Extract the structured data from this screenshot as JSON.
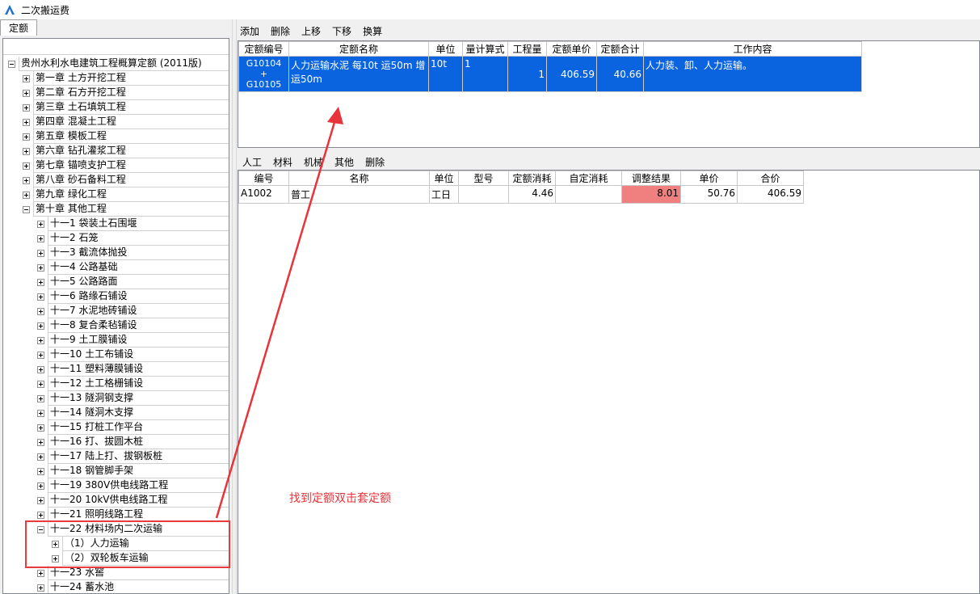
{
  "window": {
    "title": "二次搬运费",
    "icon": "app-logo-icon"
  },
  "left_tab": "定额",
  "tree": {
    "root": "贵州水利水电建筑工程概算定额 (2011版)",
    "chapters": [
      "第一章  土方开挖工程",
      "第二章  石方开挖工程",
      "第三章  土石填筑工程",
      "第四章  混凝土工程",
      "第五章  模板工程",
      "第六章  钻孔灌浆工程",
      "第七章  锚喷支护工程",
      "第八章  砂石备料工程",
      "第九章  绿化工程",
      "第十章  其他工程"
    ],
    "sections": [
      "十一1  袋装土石围堰",
      "十一2  石笼",
      "十一3  截流体抛投",
      "十一4  公路基础",
      "十一5  公路路面",
      "十一6  路缘石铺设",
      "十一7  水泥地砖铺设",
      "十一8  复合柔毡铺设",
      "十一9  土工膜铺设",
      "十一10  土工布铺设",
      "十一11  塑料薄膜铺设",
      "十一12  土工格栅铺设",
      "十一13  隧洞钢支撑",
      "十一14  隧洞木支撑",
      "十一15  打桩工作平台",
      "十一16  打、拔圆木桩",
      "十一17  陆上打、拔钢板桩",
      "十一18  钢管脚手架",
      "十一19  380V供电线路工程",
      "十一20  10kV供电线路工程",
      "十一21  照明线路工程",
      "十一22  材料场内二次运输"
    ],
    "subsections": [
      "（1）人力运输",
      "（2）双轮板车运输"
    ],
    "after": [
      "十一23  水窖",
      "十一24  蓄水池"
    ]
  },
  "top_toolbar": [
    "添加",
    "删除",
    "上移",
    "下移",
    "换算"
  ],
  "quota_table": {
    "headers": [
      "定额编号",
      "定额名称",
      "单位",
      "量计算式",
      "工程量",
      "定额单价",
      "定额合计",
      "工作内容"
    ],
    "rows": [
      {
        "code_line1": "G10104",
        "code_line2": "+",
        "code_line3": "G10105",
        "name": "人力运输水泥 每10t 运50m 增运50m",
        "unit": "10t",
        "formula": "1",
        "quantity": "1",
        "unit_price": "406.59",
        "total": "40.66",
        "work": "人力装、卸、人力运输。"
      }
    ]
  },
  "bottom_toolbar": [
    "人工",
    "材料",
    "机械",
    "其他",
    "删除"
  ],
  "resource_table": {
    "headers": [
      "编号",
      "名称",
      "单位",
      "型号",
      "定额消耗",
      "自定消耗",
      "调整结果",
      "单价",
      "合价"
    ],
    "rows": [
      {
        "code": "A1002",
        "name": "普工",
        "unit": "工日",
        "model": "",
        "quota_use": "4.46",
        "custom_use": "",
        "adjusted": "8.01",
        "price": "50.76",
        "amount": "406.59"
      }
    ]
  },
  "annotation": "找到定额双击套定额",
  "colors": {
    "selection": "#0a64e0",
    "highlight": "#f08080",
    "annotation": "#e8333a"
  }
}
